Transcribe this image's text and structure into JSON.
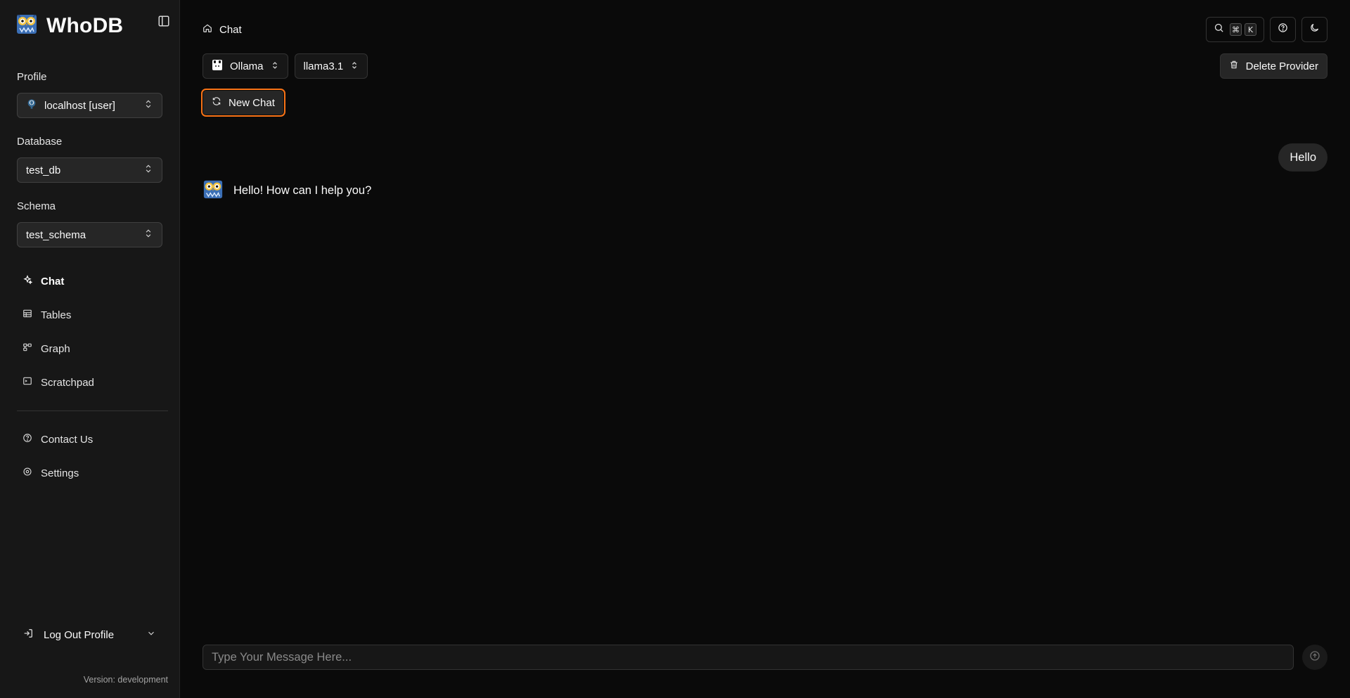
{
  "app": {
    "name": "WhoDB"
  },
  "sidebar": {
    "profile": {
      "label": "Profile",
      "value": "localhost [user]"
    },
    "database": {
      "label": "Database",
      "value": "test_db"
    },
    "schema": {
      "label": "Schema",
      "value": "test_schema"
    },
    "nav": [
      {
        "label": "Chat",
        "icon": "sparkles-icon",
        "active": true
      },
      {
        "label": "Tables",
        "icon": "table-icon",
        "active": false
      },
      {
        "label": "Graph",
        "icon": "graph-icon",
        "active": false
      },
      {
        "label": "Scratchpad",
        "icon": "terminal-icon",
        "active": false
      }
    ],
    "secondary_nav": [
      {
        "label": "Contact Us",
        "icon": "help-circle-icon"
      },
      {
        "label": "Settings",
        "icon": "gear-icon"
      }
    ],
    "logout_label": "Log Out Profile",
    "version": "Version: development"
  },
  "header": {
    "breadcrumb": "Chat",
    "shortcut_keys": [
      "⌘",
      "K"
    ]
  },
  "toolbar": {
    "provider": "Ollama",
    "model": "llama3.1",
    "new_chat_label": "New Chat",
    "delete_provider_label": "Delete Provider"
  },
  "chat": {
    "messages": [
      {
        "role": "user",
        "text": "Hello"
      },
      {
        "role": "assistant",
        "text": "Hello! How can I help you?"
      }
    ],
    "input_placeholder": "Type Your Message Here..."
  },
  "colors": {
    "background": "#0a0a0a",
    "sidebar": "#171717",
    "focus_ring": "#f97316"
  }
}
